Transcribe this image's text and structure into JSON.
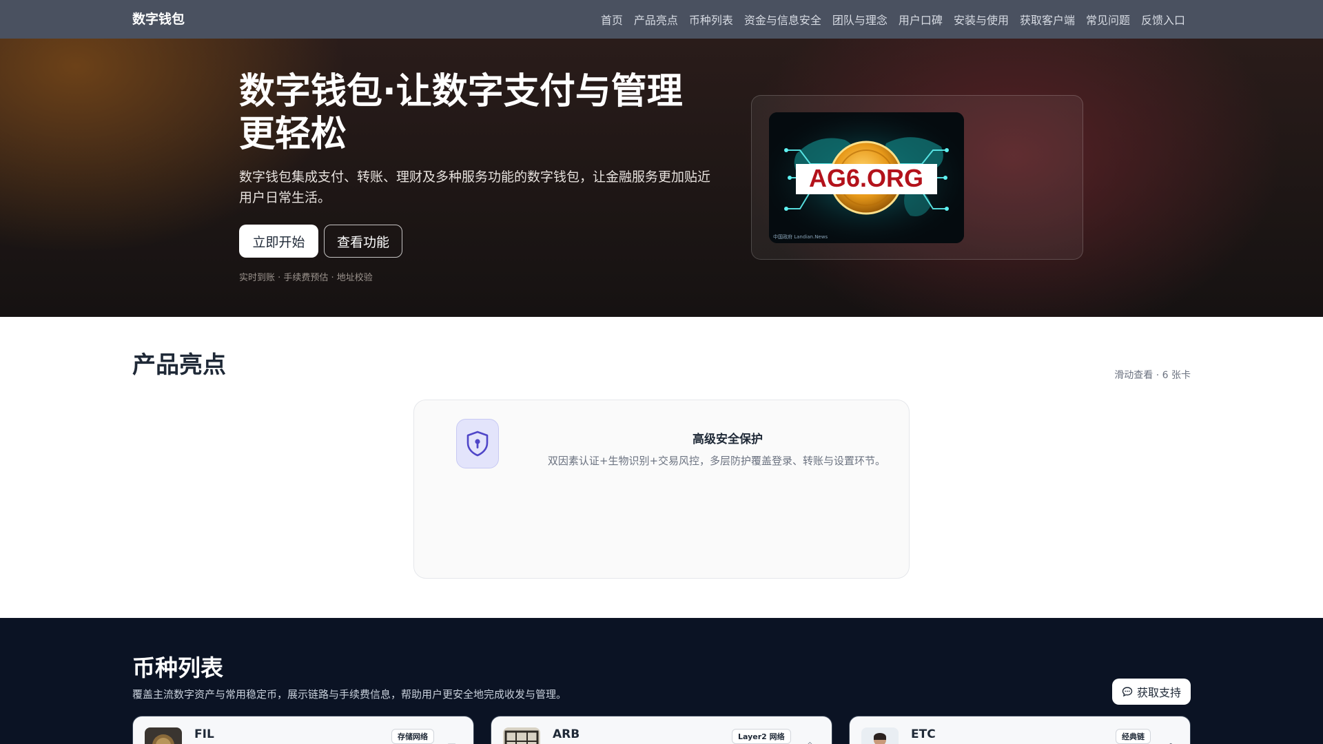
{
  "nav": {
    "brand": "数字钱包",
    "links": [
      "首页",
      "产品亮点",
      "币种列表",
      "资金与信息安全",
      "团队与理念",
      "用户口碑",
      "安装与使用",
      "获取客户端",
      "常见问题",
      "反馈入口"
    ]
  },
  "hero": {
    "title": "数字钱包·让数字支付与管理更轻松",
    "description": "数字钱包集成支付、转账、理财及多种服务功能的数字钱包，让金融服务更加贴近用户日常生活。",
    "primary_button": "立即开始",
    "secondary_button": "查看功能",
    "tags": "实时到账 · 手续费预估 · 地址校验",
    "image": {
      "overlay_text": "AG6.ORG",
      "caption": "中国政府 Landian.News"
    }
  },
  "highlights": {
    "title": "产品亮点",
    "hint": "滑动查看 · 6 张卡",
    "card": {
      "icon": "shield-lock-icon",
      "title": "高级安全保护",
      "description": "双因素认证+生物识别+交易风控，多层防护覆盖登录、转账与设置环节。"
    }
  },
  "coins": {
    "title": "币种列表",
    "description": "覆盖主流数字资产与常用稳定币，展示链路与手续费信息，帮助用户更安全地完成收发与管理。",
    "support_button": "获取支持",
    "items": [
      {
        "name": "FIL",
        "badge": "存储网络"
      },
      {
        "name": "ARB",
        "badge": "Layer2 网络"
      },
      {
        "name": "ETC",
        "badge": "经典链"
      }
    ]
  },
  "colors": {
    "nav_bg": "#4a5160",
    "hero_bg": "#1b1514",
    "coins_bg": "#0b1324",
    "accent": "#5b5bd6",
    "image_text": "#b3121b"
  }
}
